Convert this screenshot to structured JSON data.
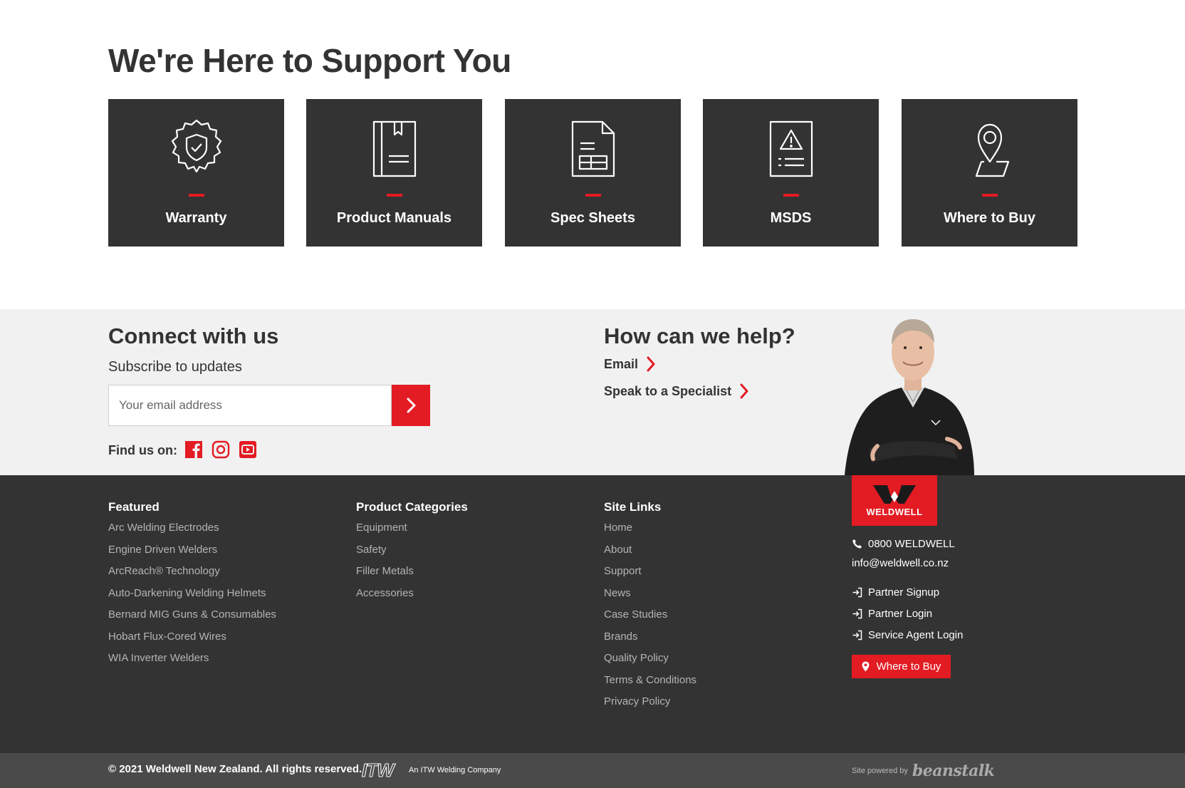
{
  "support": {
    "title": "We're Here to Support You",
    "cards": [
      {
        "label": "Warranty",
        "icon": "shield-check-icon"
      },
      {
        "label": "Product Manuals",
        "icon": "book-icon"
      },
      {
        "label": "Spec Sheets",
        "icon": "document-icon"
      },
      {
        "label": "MSDS",
        "icon": "warning-document-icon"
      },
      {
        "label": "Where to Buy",
        "icon": "map-pin-icon"
      }
    ]
  },
  "connect": {
    "title": "Connect with us",
    "subscribe_label": "Subscribe to updates",
    "email_placeholder": "Your email address",
    "find_us_label": "Find us on:",
    "socials": [
      "facebook-icon",
      "instagram-icon",
      "youtube-icon"
    ]
  },
  "help": {
    "title": "How can we help?",
    "links": [
      "Email",
      "Speak to a Specialist"
    ]
  },
  "footer": {
    "featured": {
      "heading": "Featured",
      "items": [
        "Arc Welding Electrodes",
        "Engine Driven Welders",
        "ArcReach® Technology",
        "Auto-Darkening Welding Helmets",
        "Bernard MIG Guns & Consumables",
        "Hobart Flux-Cored Wires",
        "WIA Inverter Welders"
      ]
    },
    "categories": {
      "heading": "Product Categories",
      "items": [
        "Equipment",
        "Safety",
        "Filler Metals",
        "Accessories"
      ]
    },
    "site_links": {
      "heading": "Site Links",
      "items": [
        "Home",
        "About",
        "Support",
        "News",
        "Case Studies",
        "Brands",
        "Quality Policy",
        "Terms & Conditions",
        "Privacy Policy"
      ]
    },
    "logo_text": "WELDWELL",
    "phone": "0800 WELDWELL",
    "email": "info@weldwell.co.nz",
    "partner_links": [
      "Partner Signup",
      "Partner Login",
      "Service Agent Login"
    ],
    "where_to_buy": "Where to Buy"
  },
  "bottom": {
    "copyright": "© 2021 Weldwell New Zealand. All rights reserved.",
    "itw_logo": "ITW",
    "itw_tagline": "An ITW Welding Company",
    "powered_by": "Site powered by",
    "powered_brand": "beanstalk"
  },
  "colors": {
    "accent": "#e31b23",
    "dark": "#333333",
    "light_bg": "#f1f1f1"
  }
}
